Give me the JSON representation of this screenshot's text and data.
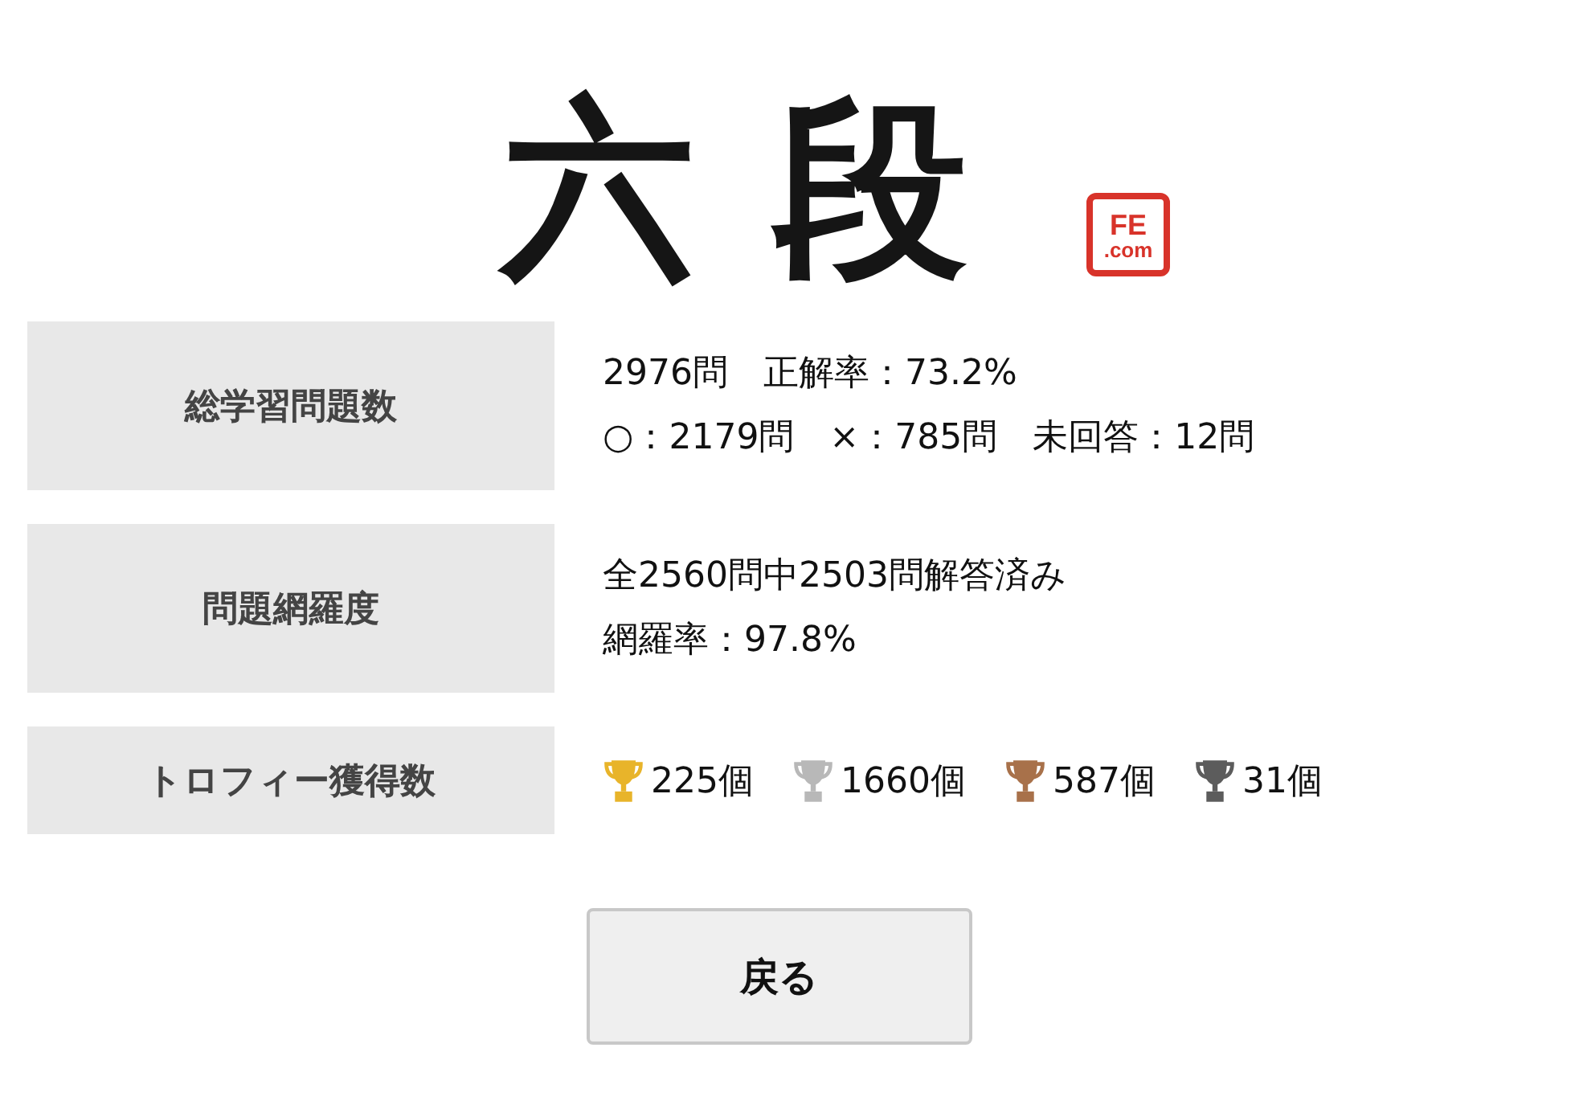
{
  "rank": {
    "title": "六段",
    "stamp": [
      "FE",
      ".com"
    ]
  },
  "stats": [
    {
      "kind": "lines",
      "label": "総学習問題数",
      "lines": [
        "2976問　正解率：73.2%",
        "○：2179問　×：785問　未回答：12問"
      ]
    },
    {
      "kind": "lines",
      "label": "問題網羅度",
      "lines": [
        "全2560問中2503問解答済み",
        "網羅率：97.8%"
      ]
    },
    {
      "kind": "trophies",
      "label": "トロフィー獲得数",
      "trophies": [
        {
          "count": "225個",
          "color": "#e8b42a"
        },
        {
          "count": "1660個",
          "color": "#b8b8b8"
        },
        {
          "count": "587個",
          "color": "#a8714a"
        },
        {
          "count": "31個",
          "color": "#5c5c5c"
        }
      ]
    }
  ],
  "back_button": "戻る"
}
